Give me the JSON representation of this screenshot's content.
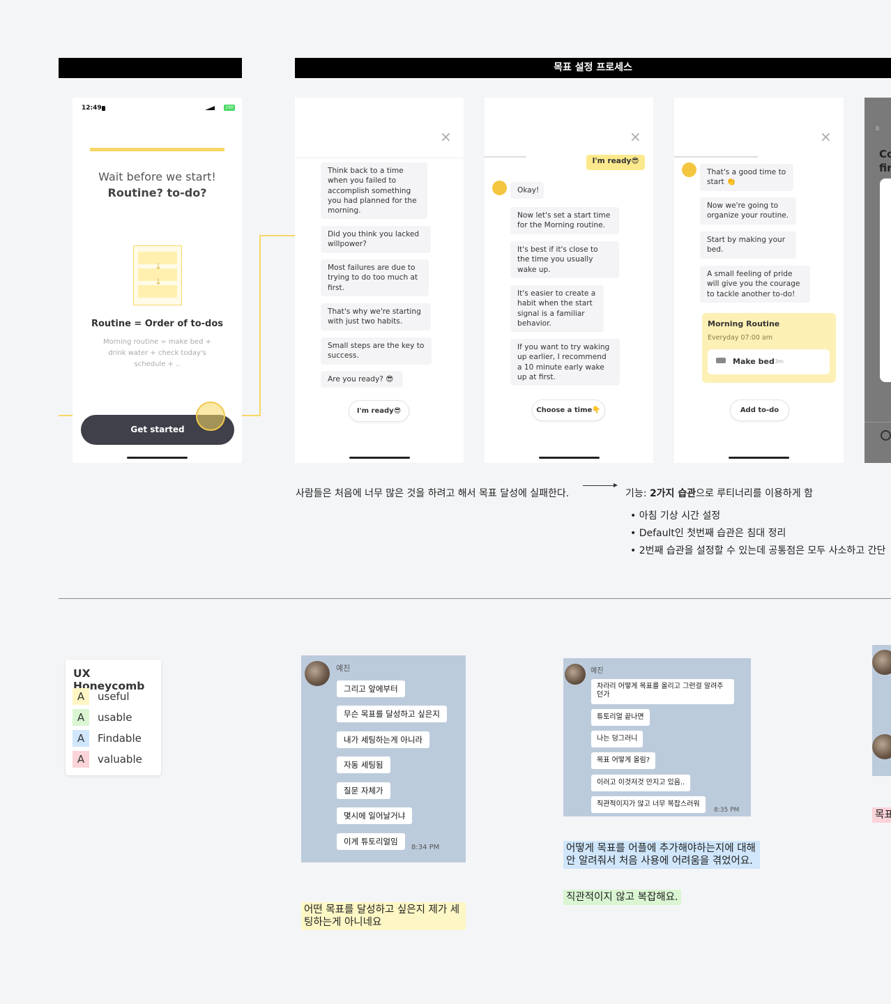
{
  "section_header": "목표 설정 프로세스",
  "screen1": {
    "time": "12:49",
    "battery": "100",
    "title_line1": "Wait before we start!",
    "title_line2": "Routine? to-do?",
    "equation": "Routine = Order of to-dos",
    "desc_line1": "Morning routine = make bed +",
    "desc_line2": "drink water + check today's",
    "desc_line3": "schedule + ..",
    "cta": "Get started"
  },
  "screen2": {
    "bubbles": [
      "Think back to a time when you failed to accomplish something you had planned for the morning.",
      "Did you think you lacked willpower?",
      "Most failures are due to trying to do too much at first.",
      "That's why we're starting with just two habits.",
      "Small steps are the key to success.",
      "Are you ready? 😎"
    ],
    "button": "I'm ready😎"
  },
  "screen3": {
    "user_reply": "I'm ready😎",
    "bubbles": [
      "Okay!",
      "Now let's set a start time for the Morning routine.",
      "It's best if it's close to the time you usually wake up.",
      "It's easier to create a habit when the start signal is a familiar behavior.",
      "If you want to try waking up earlier, I recommend a 10 minute early wake up at first."
    ],
    "button": "Choose a time👇"
  },
  "screen4": {
    "bubbles": [
      "That's a good time to start 👏",
      "Now we're going to organize your routine.",
      "Start by making your bed.",
      "A small feeling of pride will give you the courage to tackle another to-do!"
    ],
    "card_title": "Morning Routine",
    "card_sub": "Everyday 07:00 am",
    "item_label": "Make bed",
    "item_duration": "3m",
    "button": "Add to-do"
  },
  "screen5": {
    "peek_line1": "Co",
    "peek_line2": "fir",
    "peek_small": "0"
  },
  "notes": {
    "problem": "사람들은 처음에 너무 많은 것을 하려고 해서 목표 달성에 실패한다.",
    "feature_prefix": "기능: ",
    "feature_bold": "2가지 습관",
    "feature_suffix": "으로 루티너리를 이용하게 함",
    "bullets": [
      "아침 기상 시간 설정",
      "Default인 첫번째 습관은 침대 정리",
      "2번째 습관을 설정할 수 있는데 공통점은 모두 사소하고 간단"
    ]
  },
  "honeycomb": {
    "title": "UX Honeycomb",
    "items": [
      {
        "letter": "A",
        "label": "useful",
        "color": "#fff6c4"
      },
      {
        "letter": "A",
        "label": "usable",
        "color": "#d9f5d2"
      },
      {
        "letter": "A",
        "label": "Findable",
        "color": "#cfe6fb"
      },
      {
        "letter": "A",
        "label": "valuable",
        "color": "#fbd3d8"
      }
    ]
  },
  "chat1": {
    "name": "예진",
    "messages": [
      "그리고 앞에부터",
      "무슨 목표를 달성하고 싶은지",
      "내가 세팅하는게 아니라",
      "자동 세팅됨",
      "질문 자체가",
      "몇시에 일어날거냐",
      "이게 튜토리얼임"
    ],
    "time": "8:34 PM",
    "note": "어떤 목표를 달성하고 싶은지 제가 세팅하는게 아니네요"
  },
  "chat2": {
    "name": "예진",
    "messages": [
      "차라리 어떻게 목표를 올리고 그런걸 알려주던가",
      "튜토리얼 끝나면",
      "나는 덩그러니",
      "목표 어떻게 올림?",
      "이러고 이것저것 만지고 있음..",
      "직관적이지가 않고 너무 복잡스러워"
    ],
    "time": "8:35 PM",
    "note1": "어떻게 목표를 어플에 추가해야하는지에 대해 안 알려줘서 처음 사용에 어려움을 겪었어요.",
    "note2": "직관적이지 않고 복잡해요."
  },
  "peek_note": "목표",
  "colors": {
    "accent_yellow": "#f7d764",
    "dark_button": "#3f4049",
    "chat_bg": "#bccbdc"
  }
}
